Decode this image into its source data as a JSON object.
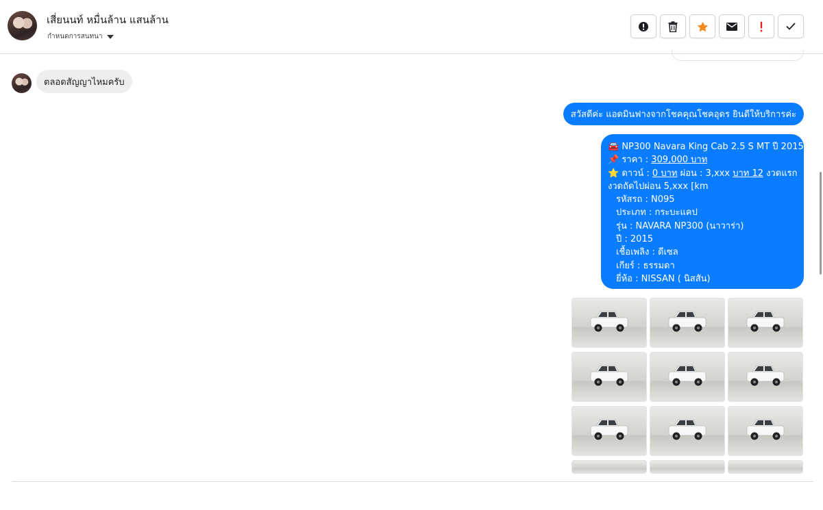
{
  "header": {
    "contact_name": "เสี่ยนนท์ หมื่นล้าน แสนล้าน",
    "conversation_link": "กำหนดการสนทนา",
    "toolbar": [
      {
        "name": "spam-alert-button",
        "icon": "exclamation-circle-icon"
      },
      {
        "name": "delete-button",
        "icon": "trash-icon"
      },
      {
        "name": "star-button",
        "icon": "star-icon",
        "color": "#f48a21"
      },
      {
        "name": "mark-unread-button",
        "icon": "envelope-icon"
      },
      {
        "name": "important-button",
        "icon": "exclamation-icon",
        "color": "#e02020"
      },
      {
        "name": "mark-done-button",
        "icon": "check-icon"
      }
    ]
  },
  "messages": {
    "incoming": "ตลอดสัญญาไหมครับ",
    "greeting": "สวัสดีค่ะ แอดมินฟางจากโชคคุณโชคอุดร ยินดีให้บริการค่ะ",
    "car_card": {
      "model_line": "NP300 Navara King Cab 2.5 S MT ปี 2015",
      "price_label": "ราคา :",
      "price_value": "309,000 บาท",
      "down_label": "ดาวน์ :",
      "down_value": "0 บาท",
      "installment_prefix": "ผ่อน : 3,xxx",
      "installment_link": "บาท 12",
      "installment_suffix": "งวดแรก",
      "next_line": "งวดถัดไปผ่อน 5,xxx [km",
      "code": "รหัสรถ : N095",
      "type": "ประเภท : กระบะแคป",
      "model": "รุ่น : NAVARA NP300 (นาวาร่า)",
      "year": "ปี : 2015",
      "fuel": "เชื้อเพลิง : ดีเซล",
      "gear": "เกียร์ : ธรรมดา",
      "brand": "ยี่ห้อ : NISSAN ( นิสสัน)"
    },
    "bubble_color": "#0a7cff",
    "photo_count": 12
  }
}
